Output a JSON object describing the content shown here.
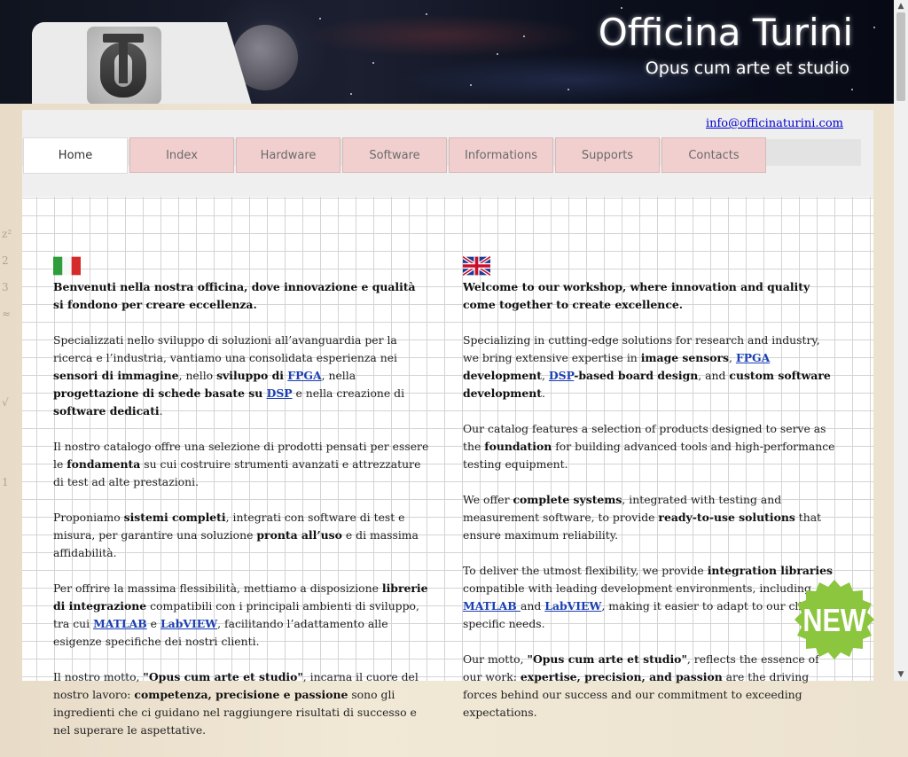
{
  "header": {
    "title": "Officina Turini",
    "subtitle": "Opus cum arte et studio"
  },
  "contact": {
    "email": "info@officinaturini.com"
  },
  "nav": {
    "tabs": [
      {
        "label": "Home",
        "active": true
      },
      {
        "label": "Index",
        "active": false
      },
      {
        "label": "Hardware",
        "active": false
      },
      {
        "label": "Software",
        "active": false
      },
      {
        "label": "Informations",
        "active": false
      },
      {
        "label": "Supports",
        "active": false
      },
      {
        "label": "Contacts",
        "active": false
      }
    ]
  },
  "italian": {
    "p1": "Benvenuti nella nostra officina, dove innovazione e qualità si fondono per creare eccellenza.",
    "p2": {
      "t1": "Specializzati nello sviluppo di soluzioni all’avanguardia per la ricerca e l’industria, vantiamo una consolidata esperienza nei ",
      "b1": "sensori di immagine",
      "t2": ", nello ",
      "b2": "sviluppo di ",
      "link1": "FPGA",
      "t3": ", nella ",
      "b3": "progettazione di schede basate su ",
      "link2": "DSP",
      "t4": " e nella creazione di ",
      "b4": "software dedicati",
      "t5": "."
    },
    "p3": {
      "t1": "Il nostro catalogo offre una selezione di prodotti pensati per essere le ",
      "b1": "fondamenta",
      "t2": " su cui costruire strumenti avanzati e attrezzature di test ad alte prestazioni."
    },
    "p4": {
      "t1": "Proponiamo ",
      "b1": "sistemi completi",
      "t2": ", integrati con software di test e misura, per garantire una soluzione ",
      "b2": "pronta all’uso",
      "t3": " e di massima affidabilità."
    },
    "p5": {
      "t1": "Per offrire la massima flessibilità, mettiamo a disposizione ",
      "b1": "librerie di integrazione",
      "t2": " compatibili con i principali ambienti di sviluppo, tra cui ",
      "link1": "MATLAB",
      "t3": " e ",
      "link2": "LabVIEW",
      "t4": ", facilitando l’adattamento alle esigenze specifiche dei nostri clienti."
    },
    "p6": {
      "t1": "Il nostro motto, ",
      "b1": "\"Opus cum arte et studio\"",
      "t2": ", incarna il cuore del nostro lavoro: ",
      "b2": "competenza, precisione e passione",
      "t3": " sono gli ingredienti che ci guidano nel raggiungere risultati di successo e nel superare le aspettative."
    }
  },
  "english": {
    "p1": "Welcome to our workshop, where innovation and quality come together to create excellence.",
    "p2": {
      "t1": "Specializing in cutting-edge solutions for research and industry, we bring extensive expertise in ",
      "b1": "image sensors",
      "t2": ", ",
      "link1": "FPGA",
      "b2": " development",
      "t3": ", ",
      "link2": "DSP",
      "b3": "-based board design",
      "t4": ", and ",
      "b4": "custom software development",
      "t5": "."
    },
    "p3": {
      "t1": "Our catalog features a selection of products designed to serve as the ",
      "b1": "foundation",
      "t2": " for building advanced tools and high-performance testing equipment."
    },
    "p4": {
      "t1": "We offer ",
      "b1": "complete systems",
      "t2": ", integrated with testing and measurement software, to provide ",
      "b2": "ready-to-use solutions",
      "t3": " that ensure maximum reliability."
    },
    "p5": {
      "t1": "To deliver the utmost flexibility, we provide ",
      "b1": "integration libraries",
      "t2": " compatible with leading development environments, including ",
      "link1": "MATLAB ",
      "t3": "and ",
      "link2": "LabVIEW",
      "t4": ", making it easier to adapt to our clients’ specific needs."
    },
    "p6": {
      "t1": "Our motto, ",
      "b1": "\"Opus cum arte et studio\"",
      "t2": ", reflects the essence of our work: ",
      "b2": "expertise, precision, and passion",
      "t3": " are the driving forces behind our success and our commitment to exceeding expectations."
    }
  },
  "badge": {
    "label": "NEW"
  },
  "colors": {
    "tab_bg": "#f2cfcf",
    "link": "#1a3fb4",
    "badge_green": "#8cc63f"
  }
}
